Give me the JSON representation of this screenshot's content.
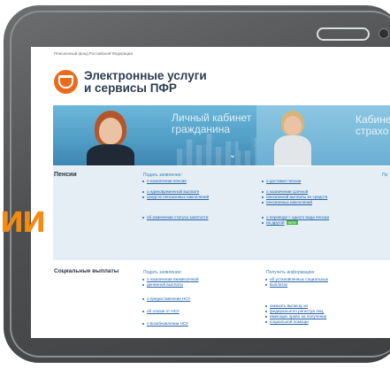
{
  "page": {
    "caption": "Пенсионный фонд Российской Федерации",
    "title_line_1": "Электронные услуги",
    "title_line_2": "и сервисы ПФР"
  },
  "banner": {
    "card_1_line_1": "Личный кабинет",
    "card_1_line_2": "гражданина",
    "card_2_line_1": "Кабинет",
    "card_2_line_2": "страхо"
  },
  "sections": {
    "pension": {
      "title": "Пенсии",
      "col1_heading": "Подать заявление:",
      "col1_links": [
        "о назначении пенсии",
        "о единовременной выплате",
        "средств пенсионных накоплений",
        "об изменении статуса занятости"
      ],
      "col2_links": [
        "о доставке пенсии",
        "о назначении срочной",
        "пенсионной выплаты из средств",
        "пенсионных накоплений",
        "о переводе с одного вида пенсии",
        "на другой"
      ],
      "col2_badge": "NEW",
      "col3_heading": "По"
    },
    "social": {
      "title": "Социальные выплаты",
      "col1_heading": "Подать заявление:",
      "col1_links": [
        "о назначении ежемесячной",
        "денежной выплаты",
        "о предоставлении НСУ",
        "об отказе от НСУ",
        "о возобновлении НСУ"
      ],
      "col2_heading": "Получить информацию:",
      "col2_links": [
        "об установленных социальных",
        "выплатах",
        "заказать выписку из",
        "федерального регистра лиц,",
        "имеющих право на получение",
        "социальной помощи"
      ]
    }
  },
  "overlay": {
    "promo_text": "ии"
  },
  "colors": {
    "brand_orange": "#ea6b1c",
    "link_blue": "#2563a8",
    "banner_blue": "#4f9cc5",
    "promo_orange": "#f28a13"
  },
  "icons": {
    "logo": "pfr-logo-icon",
    "scroll": "chevron-down-icon",
    "speaker": "tablet-speaker-icon",
    "camera": "tablet-camera-icon"
  }
}
